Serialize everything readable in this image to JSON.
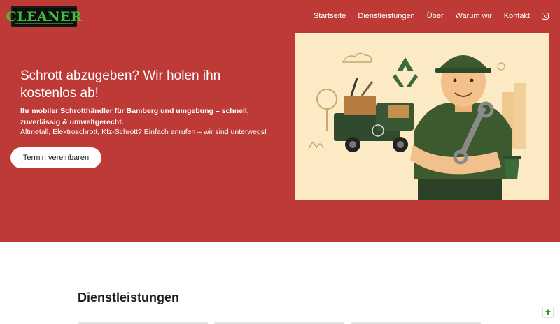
{
  "header": {
    "logo_text": "CLEANER",
    "nav": [
      "Startseite",
      "Dienstleistungen",
      "Über",
      "Warum wir",
      "Kontakt"
    ],
    "social_icon": "instagram-icon"
  },
  "hero": {
    "headline": "Schrott abzugeben? Wir holen ihn kostenlos ab!",
    "subline_bold": "Ihr mobiler Schrotthändler für Bamberg und umgebung – schnell, zuverlässig & umweltgerecht.",
    "subline": "Altmetall, Elektroschrott, Kfz-Schrott? Einfach anrufen – wir sind unterwegs!",
    "cta_label": "Termin vereinbaren",
    "illustration": "scrap-dealer-worker-with-wrench-and-truck",
    "colors": {
      "hero_bg": "#bd3a37",
      "illustration_bg": "#fbeac4",
      "accent_green": "#3c5a2e"
    }
  },
  "services": {
    "title": "Dienstleistungen"
  },
  "scroll_top_icon": "arrow-up-icon"
}
